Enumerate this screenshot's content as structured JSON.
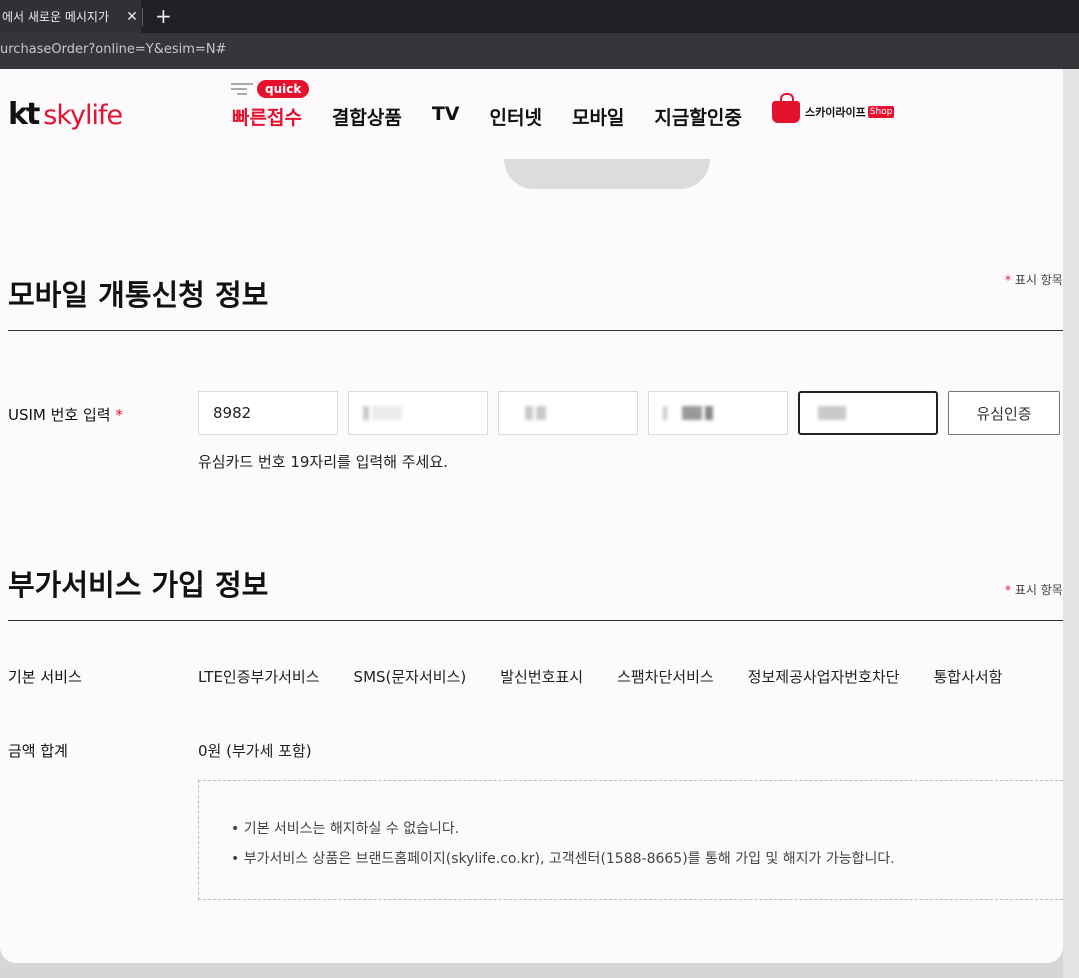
{
  "browser": {
    "tab_title": "에서 새로운 메시지가",
    "tab_close": "✕",
    "new_tab": "+",
    "url": "urchaseOrder?online=Y&esim=N#"
  },
  "header": {
    "logo_kt": "kt",
    "logo_sky": "skylife",
    "quick_badge": "quick",
    "nav": [
      "빠른접수",
      "결합상품",
      "TV",
      "인터넷",
      "모바일",
      "지금할인중"
    ],
    "shop_label": "스카이라이프",
    "shop_tag": "Shop"
  },
  "mobile_section": {
    "title": "모바일 개통신청 정보",
    "required_note": "표시 항목은",
    "required_star": "*",
    "usim_label": "USIM 번호 입력",
    "usim_first": "8982",
    "usim_button": "유심인증",
    "usim_hint": "유심카드 번호 19자리를 입력해 주세요."
  },
  "addon_section": {
    "title": "부가서비스 가입 정보",
    "required_note": "표시 항목은",
    "required_star": "*",
    "basic_label": "기본 서비스",
    "services": [
      "LTE인증부가서비스",
      "SMS(문자서비스)",
      "발신번호표시",
      "스팸차단서비스",
      "정보제공사업자번호차단",
      "통합사서함"
    ],
    "total_label": "금액 합계",
    "total_value": "0원 (부가세 포함)",
    "notices": [
      "• 기본 서비스는 해지하실 수 없습니다.",
      "• 부가서비스 상품은 브랜드홈페이지(skylife.co.kr), 고객센터(1588-8665)를 통해 가입 및 해지가 가능합니다."
    ]
  }
}
